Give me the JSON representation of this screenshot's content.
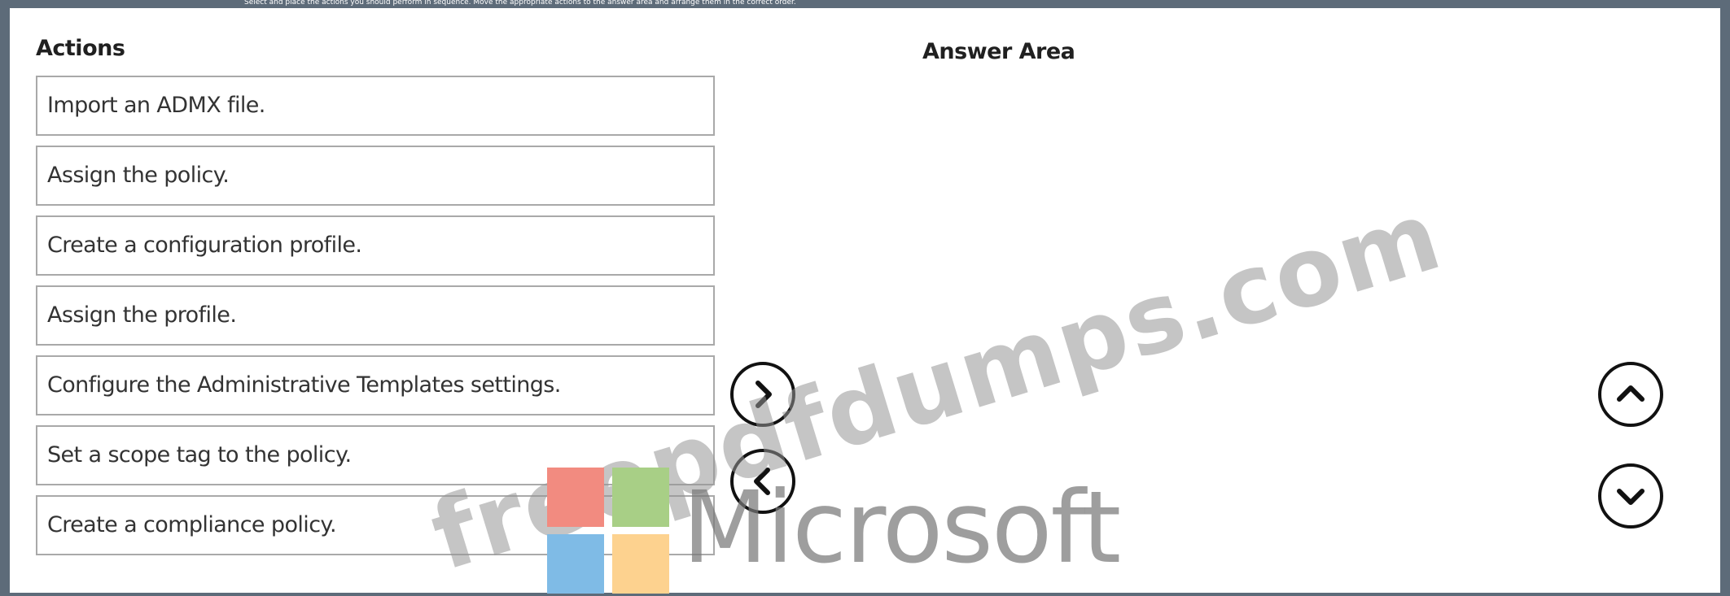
{
  "top_strip_text": "Select and place the actions you should perform in sequence. Move the appropriate actions to the answer area and arrange them in the correct order.",
  "actions_heading": "Actions",
  "answer_heading": "Answer Area",
  "actions": [
    {
      "label": "Import an ADMX file."
    },
    {
      "label": "Assign the policy."
    },
    {
      "label": "Create a configuration profile."
    },
    {
      "label": "Assign the profile."
    },
    {
      "label": "Configure the Administrative Templates settings."
    },
    {
      "label": "Set a scope tag to the policy."
    },
    {
      "label": "Create a compliance policy."
    }
  ],
  "controls": {
    "move_right_icon": "chevron-right-icon",
    "move_left_icon": "chevron-left-icon",
    "move_up_icon": "chevron-up-icon",
    "move_down_icon": "chevron-down-icon"
  },
  "watermark": {
    "site_text": "freepdfdumps.com",
    "brand_text": "Microsoft",
    "colors": {
      "red": "#f28b80",
      "green": "#a8cf86",
      "blue": "#7fbbe6",
      "yellow": "#fdd28f"
    }
  }
}
